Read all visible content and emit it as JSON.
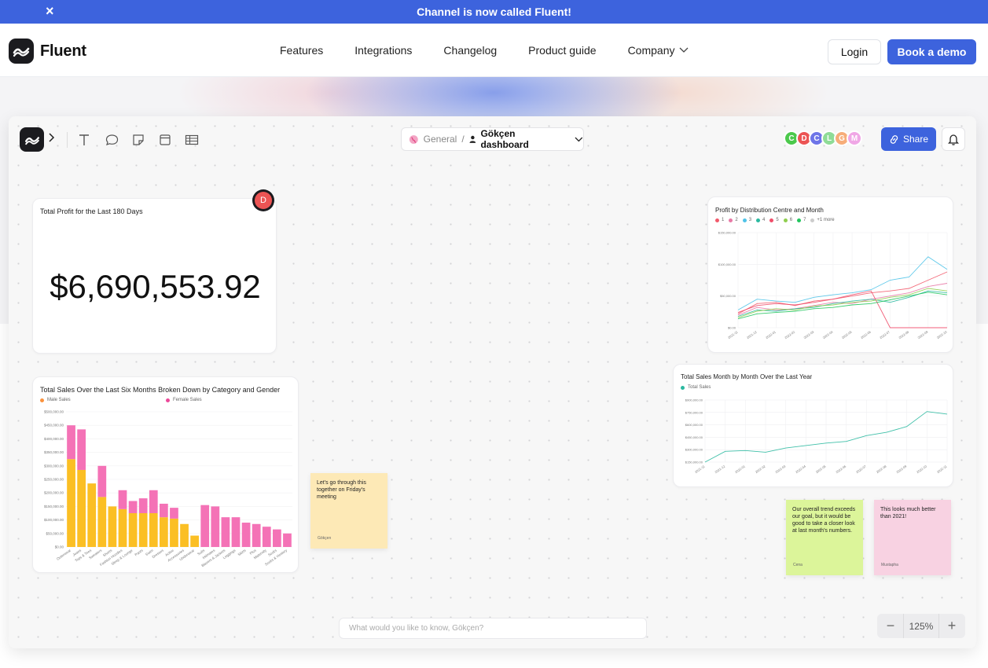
{
  "banner": {
    "text": "Channel is now called Fluent!",
    "close_icon": "×"
  },
  "nav": {
    "brand": "Fluent",
    "links": [
      "Features",
      "Integrations",
      "Changelog",
      "Product guide",
      "Company"
    ],
    "login": "Login",
    "demo": "Book a demo"
  },
  "app": {
    "breadcrumb": {
      "space": "General",
      "separator": "/",
      "page": "Gökçen dashboard"
    },
    "avatars": [
      {
        "initial": "C",
        "color": "#4cc94c"
      },
      {
        "initial": "D",
        "color": "#ec5454"
      },
      {
        "initial": "C",
        "color": "#6e75e8"
      },
      {
        "initial": "L",
        "color": "#8fdc97"
      },
      {
        "initial": "G",
        "color": "#f7ad79"
      },
      {
        "initial": "M",
        "color": "#f0a7e6"
      }
    ],
    "share": "Share",
    "ask_placeholder": "What would you like to know, Gökçen?",
    "zoom": {
      "minus": "−",
      "level": "125%",
      "plus": "+"
    },
    "comment_badge": "D"
  },
  "kpi": {
    "title": "Total Profit for the Last 180 Days",
    "value": "$6,690,553.92"
  },
  "stickies": [
    {
      "text": "Let's go through this together on Friday's meeting",
      "author": "Gökçen",
      "color": "#fde9b6"
    },
    {
      "text": "Our overall trend exceeds our goal, but it would be good to take a closer look at last month's numbers.",
      "author": "Cena",
      "color": "#dcf59a"
    },
    {
      "text": "This looks much better than 2021!",
      "author": "Mustapha",
      "color": "#f8d2e2"
    }
  ],
  "chart_data": [
    {
      "type": "bar",
      "title": "Total Sales Over the Last Six Months Broken Down by Category and Gender",
      "categories": [
        "Outerwear",
        "Jeans",
        "Tops & Tees",
        "Sweaters",
        "Shorts",
        "Fashion Hoodies",
        "Sleep & Lounge",
        "Pants",
        "Swim",
        "Dresses",
        "Active",
        "Accessories",
        "Underwear",
        "Suits",
        "Intimates",
        "Blazers & Jackets",
        "Leggings",
        "Skirts",
        "Plus",
        "Maternity",
        "Socks",
        "Socks & Hosiery"
      ],
      "series": [
        {
          "name": "Male Sales",
          "color": "#fbbf24",
          "values": [
            325000,
            285000,
            235000,
            185000,
            150000,
            140000,
            125000,
            125000,
            125000,
            110000,
            105000,
            85000,
            42000,
            0,
            0,
            0,
            0,
            0,
            0,
            0,
            0,
            0
          ]
        },
        {
          "name": "Female Sales",
          "color": "#f472b6",
          "values": [
            125000,
            150000,
            0,
            115000,
            0,
            70000,
            45000,
            55000,
            85000,
            50000,
            40000,
            0,
            0,
            155000,
            150000,
            110000,
            110000,
            90000,
            85000,
            75000,
            65000,
            50000
          ]
        }
      ],
      "yticks": [
        "$0.00",
        "$50,000.00",
        "$100,000.00",
        "$150,000.00",
        "$200,000.00",
        "$250,000.00",
        "$300,000.00",
        "$350,000.00",
        "$400,000.00",
        "$450,000.00",
        "$500,000.00"
      ],
      "ylim": [
        0,
        500000
      ]
    },
    {
      "type": "line",
      "title": "Profit by Distribution Centre and Month",
      "legend_extra": "+1 more",
      "x": [
        "2021-11",
        "2021-12",
        "2022-01",
        "2022-02",
        "2022-03",
        "2022-04",
        "2022-05",
        "2022-06",
        "2022-07",
        "2022-08",
        "2022-09",
        "2022-10"
      ],
      "yticks": [
        "$0.00",
        "$50,000.00",
        "$100,000.00",
        "$150,000.00"
      ],
      "ylim": [
        0,
        150000
      ],
      "series": [
        {
          "name": "1",
          "color": "#f25a6b",
          "values": [
            22000,
            38000,
            40000,
            35000,
            42000,
            45000,
            50000,
            55000,
            58000,
            62000,
            75000,
            88000
          ]
        },
        {
          "name": "2",
          "color": "#e879a6",
          "values": [
            20000,
            32000,
            28000,
            30000,
            35000,
            40000,
            38000,
            45000,
            50000,
            55000,
            65000,
            70000
          ]
        },
        {
          "name": "3",
          "color": "#4fc3e8",
          "values": [
            28000,
            45000,
            42000,
            40000,
            48000,
            52000,
            55000,
            60000,
            75000,
            80000,
            112000,
            92000
          ]
        },
        {
          "name": "4",
          "color": "#2bb9a0",
          "values": [
            18000,
            28000,
            26000,
            30000,
            32000,
            38000,
            42000,
            45000,
            40000,
            48000,
            58000,
            55000
          ]
        },
        {
          "name": "5",
          "color": "#f04e6a",
          "values": [
            24000,
            35000,
            38000,
            36000,
            40000,
            45000,
            52000,
            58000,
            0,
            0,
            0,
            0
          ]
        },
        {
          "name": "6",
          "color": "#8fce4f",
          "values": [
            16000,
            26000,
            30000,
            28000,
            34000,
            36000,
            40000,
            42000,
            48000,
            52000,
            62000,
            58000
          ]
        },
        {
          "name": "7",
          "color": "#22c55e",
          "values": [
            14000,
            22000,
            24000,
            26000,
            30000,
            32000,
            36000,
            38000,
            44000,
            50000,
            56000,
            52000
          ]
        }
      ]
    },
    {
      "type": "line",
      "title": "Total Sales Month by Month Over the Last Year",
      "x": [
        "2021-11",
        "2021-12",
        "2022-01",
        "2022-02",
        "2022-03",
        "2022-04",
        "2022-05",
        "2022-06",
        "2022-07",
        "2022-08",
        "2022-09",
        "2022-10",
        "2022-11"
      ],
      "yticks": [
        "$150,000.00",
        "$300,000.00",
        "$450,000.00",
        "$600,000.00",
        "$750,000.00",
        "$900,000.00"
      ],
      "ylim": [
        150000,
        900000
      ],
      "series": [
        {
          "name": "Total Sales",
          "color": "#2bb9a0",
          "values": [
            150000,
            280000,
            290000,
            270000,
            320000,
            350000,
            380000,
            400000,
            470000,
            510000,
            580000,
            760000,
            730000
          ]
        }
      ]
    }
  ]
}
